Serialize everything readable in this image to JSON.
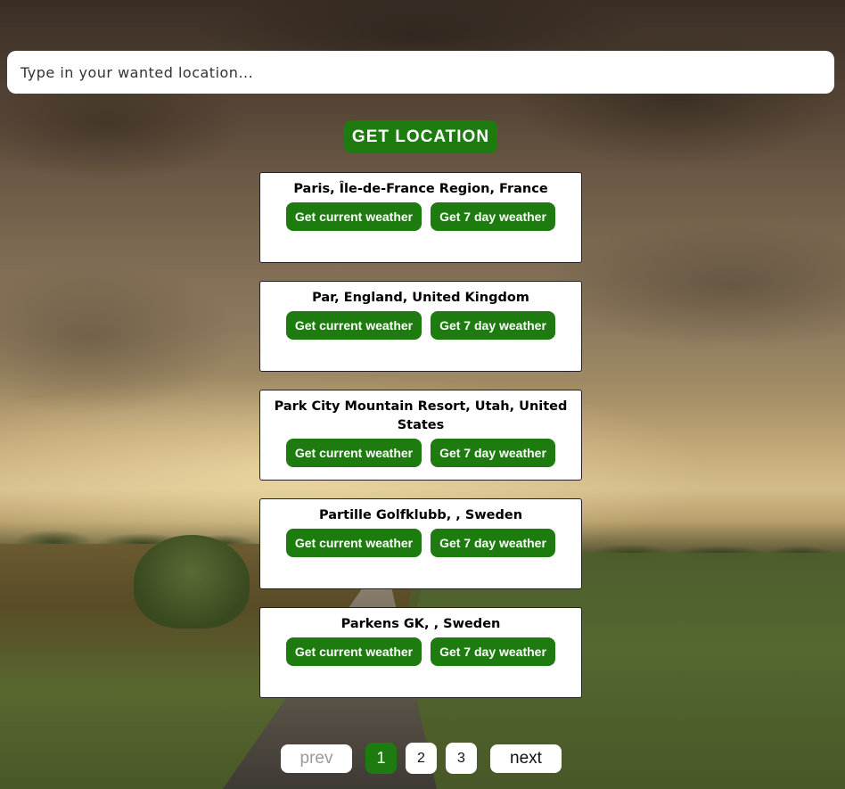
{
  "search": {
    "placeholder": "Type in your wanted location...",
    "value": ""
  },
  "get_location_label": "GET LOCATION",
  "results": [
    {
      "name": "Paris, Île-de-France Region, France",
      "current_label": "Get current weather",
      "seven_day_label": "Get 7 day weather"
    },
    {
      "name": "Par, England, United Kingdom",
      "current_label": "Get current weather",
      "seven_day_label": "Get 7 day weather"
    },
    {
      "name": "Park City Mountain Resort, Utah, United States",
      "current_label": "Get current weather",
      "seven_day_label": "Get 7 day weather"
    },
    {
      "name": "Partille Golfklubb, , Sweden",
      "current_label": "Get current weather",
      "seven_day_label": "Get 7 day weather"
    },
    {
      "name": "Parkens GK, , Sweden",
      "current_label": "Get current weather",
      "seven_day_label": "Get 7 day weather"
    }
  ],
  "pagination": {
    "prev_label": "prev",
    "next_label": "next",
    "pages": [
      "1",
      "2",
      "3"
    ],
    "current_page": "1"
  },
  "colors": {
    "accent": "#1e7b10",
    "disabled_text": "#9a9a9a"
  }
}
